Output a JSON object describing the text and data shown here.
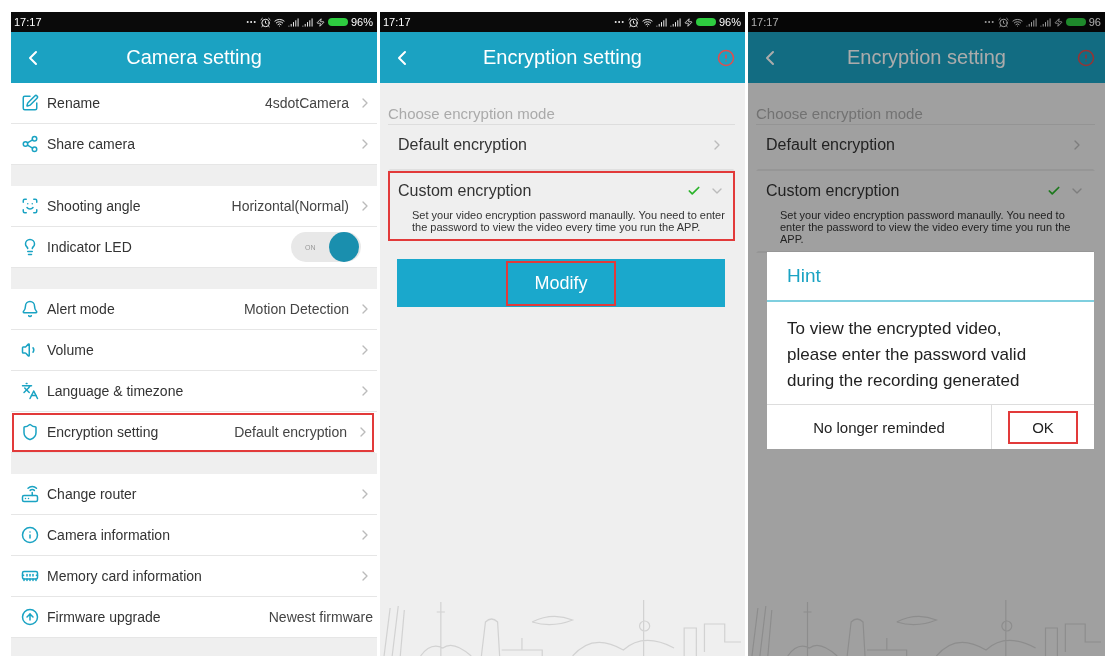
{
  "screens": [
    {
      "kind": "settings",
      "status_bar": {
        "time": "17:17",
        "battery": "96%"
      },
      "title": "Camera setting",
      "groups": [
        [
          {
            "label": "Rename",
            "value": "4sdotCamera",
            "kind": "link",
            "highlighted": false
          },
          {
            "label": "Share camera",
            "kind": "link",
            "highlighted": false
          }
        ],
        [
          {
            "label": "Shooting angle",
            "value": "Horizontal(Normal)",
            "kind": "link",
            "highlighted": false
          },
          {
            "label": "Indicator LED",
            "kind": "toggle",
            "toggle_text": "ON",
            "on": true,
            "highlighted": false
          }
        ],
        [
          {
            "label": "Alert mode",
            "value": "Motion Detection",
            "kind": "link",
            "highlighted": false
          },
          {
            "label": "Volume",
            "kind": "link",
            "highlighted": false
          },
          {
            "label": "Language & timezone",
            "kind": "link",
            "highlighted": false
          },
          {
            "label": "Encryption setting",
            "value": "Default encryption",
            "kind": "link",
            "highlighted": true
          }
        ],
        [
          {
            "label": "Change router",
            "kind": "link",
            "highlighted": false
          },
          {
            "label": "Camera information",
            "kind": "link",
            "highlighted": false
          },
          {
            "label": "Memory card information",
            "kind": "link",
            "highlighted": false
          },
          {
            "label": "Firmware upgrade",
            "value": "Newest firmware",
            "kind": "plain",
            "highlighted": false
          }
        ]
      ]
    },
    {
      "kind": "encryption",
      "status_bar": {
        "time": "17:17",
        "battery": "96%"
      },
      "title": "Encryption setting",
      "section_label": "Choose encryption mode",
      "options": [
        {
          "label": "Default encryption",
          "selected": false,
          "expanded": false,
          "highlighted": false
        },
        {
          "label": "Custom encryption",
          "selected": true,
          "expanded": true,
          "highlighted": true,
          "description": "Set your video encryption password manaully. You need to enter the password to view the video every time you run the APP."
        }
      ],
      "button": {
        "label": "Modify",
        "highlighted": true
      }
    },
    {
      "kind": "encryption",
      "status_bar": {
        "time": "17:17",
        "battery": "96"
      },
      "title": "Encryption setting",
      "section_label": "Choose encryption mode",
      "options": [
        {
          "label": "Default encryption",
          "selected": false,
          "expanded": false,
          "highlighted": false
        },
        {
          "label": "Custom encryption",
          "selected": true,
          "expanded": true,
          "highlighted": false,
          "description": "Set your video encryption password manaully. You need to enter the password to view the video every time you run the APP."
        }
      ],
      "dialog": {
        "title": "Hint",
        "message": "To view the encrypted video, please enter the password valid during the recording generated",
        "buttons": [
          {
            "label": "No longer reminded",
            "highlighted": false
          },
          {
            "label": "OK",
            "highlighted": true
          }
        ]
      }
    }
  ]
}
